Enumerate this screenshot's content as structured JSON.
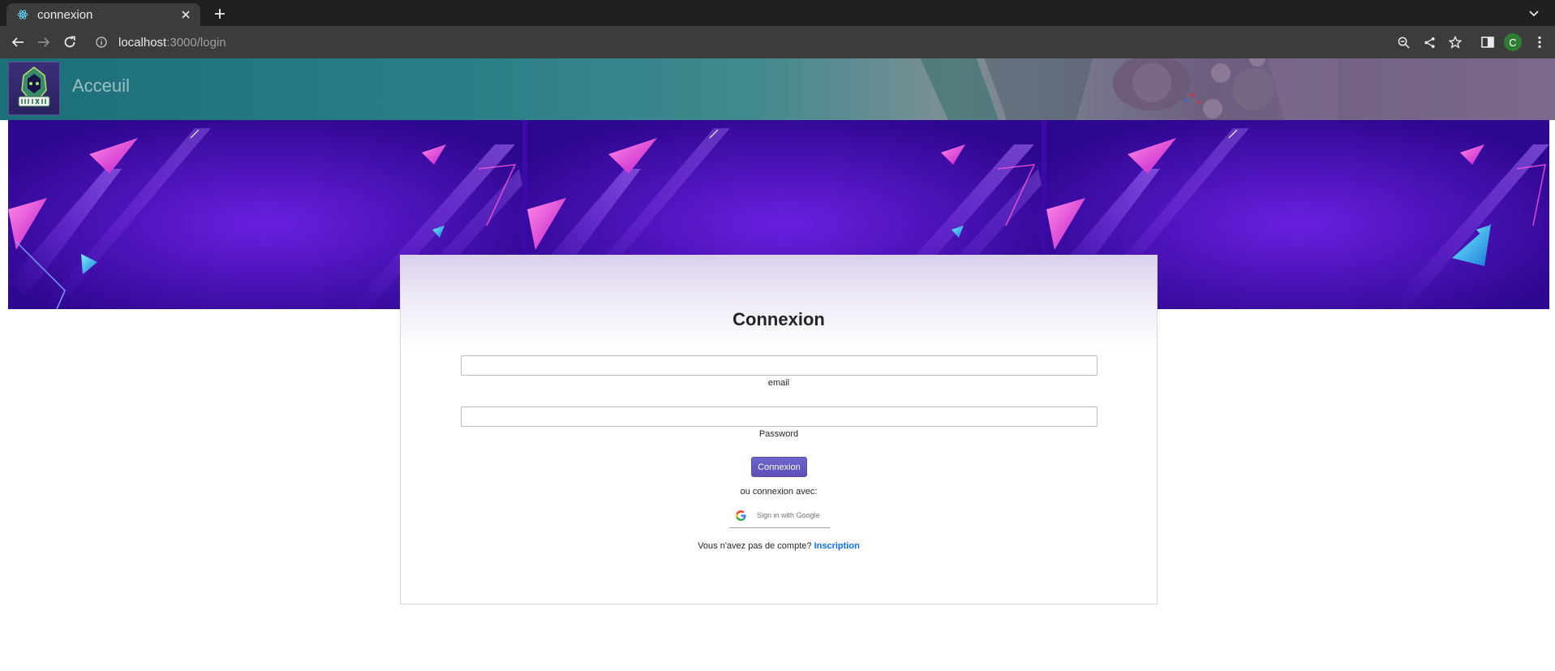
{
  "browser": {
    "tab_title": "connexion",
    "url_host": "localhost",
    "url_rest": ":3000/login",
    "profile_initial": "C",
    "icons": [
      "react-favicon-icon",
      "close-icon",
      "plus-icon",
      "chevron-down-icon",
      "back-arrow-icon",
      "forward-arrow-icon",
      "reload-icon",
      "info-icon",
      "zoom-icon",
      "share-icon",
      "star-icon",
      "side-panel-icon",
      "menu-dots-icon"
    ]
  },
  "navbar": {
    "home_link": "Acceuil"
  },
  "login": {
    "title": "Connexion",
    "email_label": "email",
    "password_label": "Password",
    "submit_label": "Connexion",
    "or_text": "ou connexion avec:",
    "google_label": "Sign in with Google",
    "signup_prompt": "Vous n'avez pas de compte? ",
    "signup_link": "Inscription"
  },
  "colors": {
    "link": "#0d6efd",
    "button": "#5c50b8",
    "banner": "#3b0aa8"
  }
}
